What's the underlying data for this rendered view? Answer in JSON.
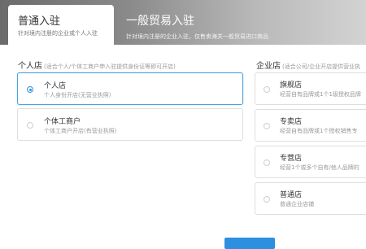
{
  "tabs": [
    {
      "title": "普通入驻",
      "subtitle": "针对境内注册的企业或个人入驻"
    },
    {
      "title": "一般贸易入驻",
      "subtitle": "针对境内注册的企业入驻，仅售卖海关一般贸易进口商品"
    }
  ],
  "left": {
    "title": "个人店",
    "hint": "(适合个人/个体工商户申入驻提供身份证等即可开店)",
    "options": [
      {
        "title": "个人店",
        "desc": "个人身份开店(无营业执照)",
        "selected": true
      },
      {
        "title": "个体工商户",
        "desc": "个体工商户开店(有营业执照)",
        "selected": false
      }
    ]
  },
  "right": {
    "title": "企业店",
    "hint": "(适合公司/企业开店提供营业执",
    "options": [
      {
        "title": "旗舰店",
        "desc": "经营自有品牌或1个1级授权品牌",
        "selected": false
      },
      {
        "title": "专卖店",
        "desc": "经营自有品牌或1个授权销售专",
        "selected": false
      },
      {
        "title": "专营店",
        "desc": "经营1个或多个自有/他人品牌的",
        "selected": false
      },
      {
        "title": "普通店",
        "desc": "普通企业店铺",
        "selected": false
      }
    ]
  }
}
